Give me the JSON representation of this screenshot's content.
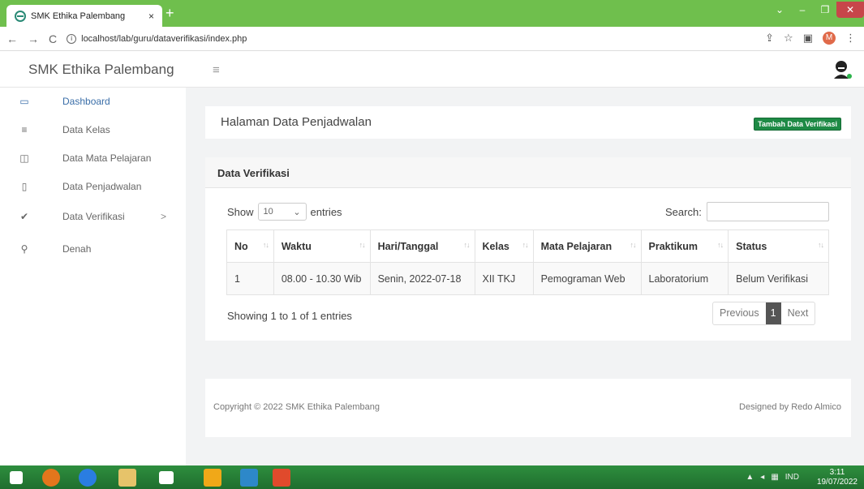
{
  "browser": {
    "tab_title": "SMK Ethika Palembang",
    "tab_close": "×",
    "new_tab": "+",
    "url": "localhost/lab/guru/dataverifikasi/index.php",
    "profile_initial": "M"
  },
  "app": {
    "brand": "SMK Ethika Palembang"
  },
  "sidebar": {
    "items": [
      {
        "label": "Dashboard",
        "icon": "laptop-icon",
        "glyph": "▭"
      },
      {
        "label": "Data Kelas",
        "icon": "list-icon",
        "glyph": "≡"
      },
      {
        "label": "Data Mata Pelajaran",
        "icon": "book-icon",
        "glyph": "◫"
      },
      {
        "label": "Data Penjadwalan",
        "icon": "file-icon",
        "glyph": "▯"
      },
      {
        "label": "Data Verifikasi",
        "icon": "check-icon",
        "glyph": "✔"
      },
      {
        "label": "Denah",
        "icon": "map-pin-icon",
        "glyph": "⚲"
      }
    ]
  },
  "header": {
    "title": "Halaman Data Penjadwalan",
    "add_button": "Tambah Data Verifikasi"
  },
  "card": {
    "title": "Data Verifikasi",
    "show_label": "Show",
    "entries_value": "10",
    "entries_label": "entries",
    "search_label": "Search:",
    "columns": [
      "No",
      "Waktu",
      "Hari/Tanggal",
      "Kelas",
      "Mata Pelajaran",
      "Praktikum",
      "Status"
    ],
    "rows": [
      [
        "1",
        "08.00 - 10.30 Wib",
        "Senin, 2022-07-18",
        "XII TKJ",
        "Pemograman Web",
        "Laboratorium",
        "Belum Verifikasi"
      ]
    ],
    "info": "Showing 1 to 1 of 1 entries",
    "pager": {
      "previous": "Previous",
      "current": "1",
      "next": "Next"
    }
  },
  "footer": {
    "copyright": "Copyright © 2022 SMK Ethika Palembang",
    "designed": "Designed by Redo Almico"
  },
  "taskbar": {
    "lang": "IND",
    "time": "3:11",
    "date": "19/07/2022"
  },
  "colors": {
    "accent": "#3a6ea8",
    "button_green": "#1e8a45",
    "taskbar": "#2e8e3e"
  }
}
